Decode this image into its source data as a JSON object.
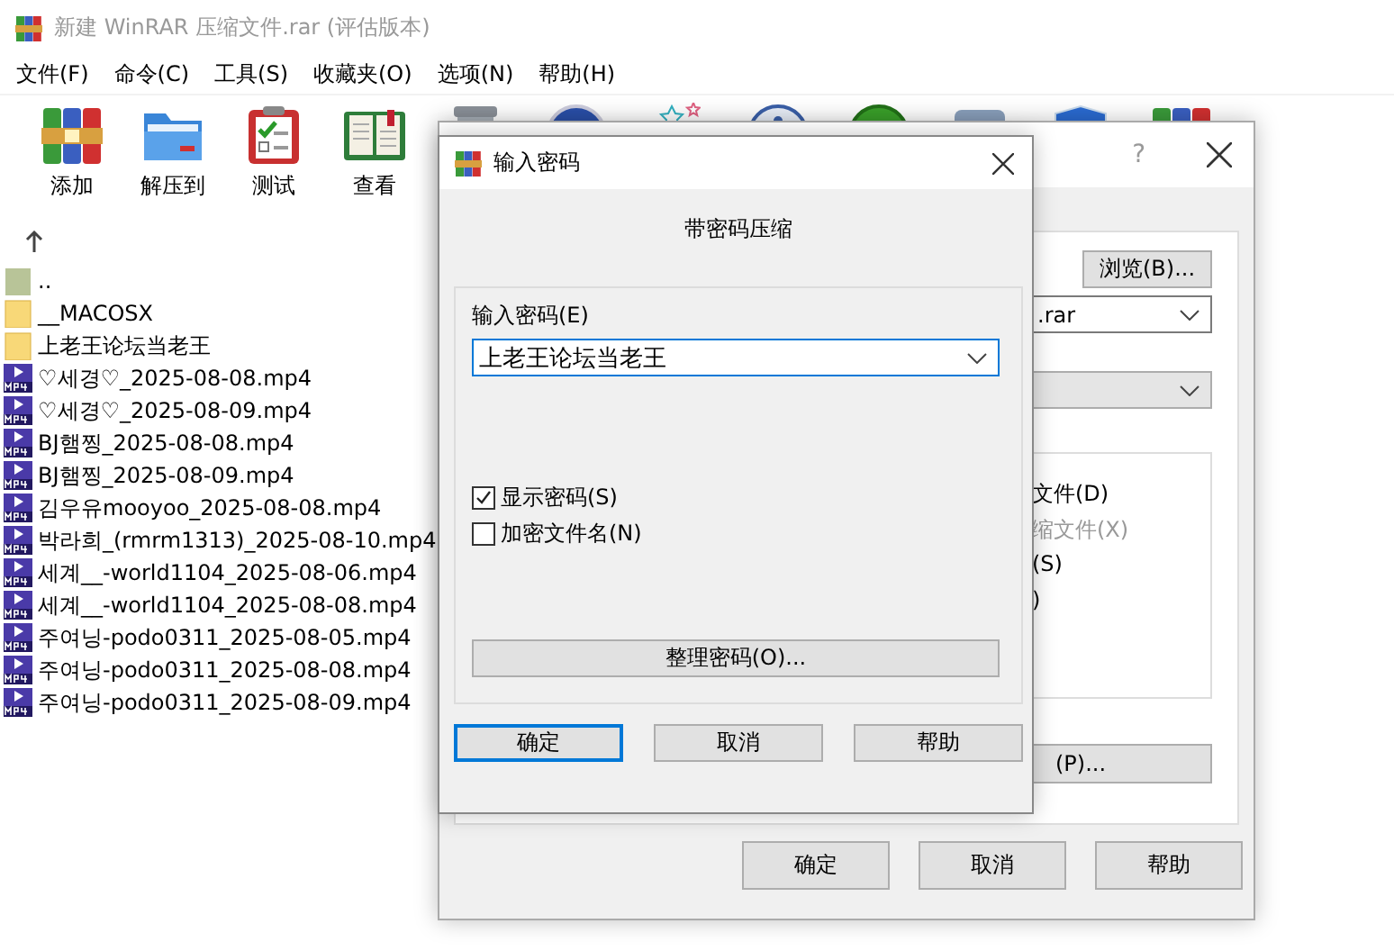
{
  "window": {
    "title": "新建 WinRAR 压缩文件.rar (评估版本)"
  },
  "menu": [
    "文件(F)",
    "命令(C)",
    "工具(S)",
    "收藏夹(O)",
    "选项(N)",
    "帮助(H)"
  ],
  "toolbar": [
    {
      "label": "添加",
      "kind": "books"
    },
    {
      "label": "解压到",
      "kind": "folder"
    },
    {
      "label": "测试",
      "kind": "clipboard"
    },
    {
      "label": "查看",
      "kind": "book"
    },
    {
      "kind": "trash"
    },
    {
      "kind": "globe"
    },
    {
      "kind": "stars"
    },
    {
      "kind": "info"
    },
    {
      "kind": "green"
    },
    {
      "kind": "box"
    },
    {
      "kind": "shield"
    },
    {
      "kind": "books"
    }
  ],
  "files": [
    {
      "name": "..",
      "kind": "parent"
    },
    {
      "name": "__MACOSX",
      "kind": "folder"
    },
    {
      "name": "上老王论坛当老王",
      "kind": "folder"
    },
    {
      "name": "♡세경♡_2025-08-08.mp4",
      "kind": "video"
    },
    {
      "name": "♡세경♡_2025-08-09.mp4",
      "kind": "video"
    },
    {
      "name": "BJ햄찡_2025-08-08.mp4",
      "kind": "video"
    },
    {
      "name": "BJ햄찡_2025-08-09.mp4",
      "kind": "video"
    },
    {
      "name": "김우유mooyoo_2025-08-08.mp4",
      "kind": "video"
    },
    {
      "name": "박라희_(rmrm1313)_2025-08-10.mp4",
      "kind": "video"
    },
    {
      "name": "세계__-world1104_2025-08-06.mp4",
      "kind": "video"
    },
    {
      "name": "세계__-world1104_2025-08-08.mp4",
      "kind": "video"
    },
    {
      "name": "주여닝-podo0311_2025-08-05.mp4",
      "kind": "video"
    },
    {
      "name": "주여닝-podo0311_2025-08-08.mp4",
      "kind": "video"
    },
    {
      "name": "주여닝-podo0311_2025-08-09.mp4",
      "kind": "video"
    }
  ],
  "archive_dialog": {
    "help_glyph": "?",
    "browse": "浏览(B)...",
    "archive_name": ".rar",
    "options": [
      {
        "label": "文件(D)",
        "disabled": false
      },
      {
        "label": "缩文件(X)",
        "disabled": true
      },
      {
        "label": "(S)",
        "disabled": false
      },
      {
        "label": ")",
        "disabled": false
      }
    ],
    "password_button": "(P)...",
    "buttons": [
      "确定",
      "取消",
      "帮助"
    ]
  },
  "password_dialog": {
    "title": "输入密码",
    "heading": "带密码压缩",
    "label": "输入密码(E)",
    "value": "上老王论坛当老王",
    "checkboxes": [
      {
        "label": "显示密码(S)",
        "checked": true
      },
      {
        "label": "加密文件名(N)",
        "checked": false
      }
    ],
    "organize": "整理密码(O)...",
    "buttons": [
      {
        "label": "确定",
        "selected": true
      },
      {
        "label": "取消",
        "selected": false
      },
      {
        "label": "帮助",
        "selected": false
      }
    ]
  }
}
